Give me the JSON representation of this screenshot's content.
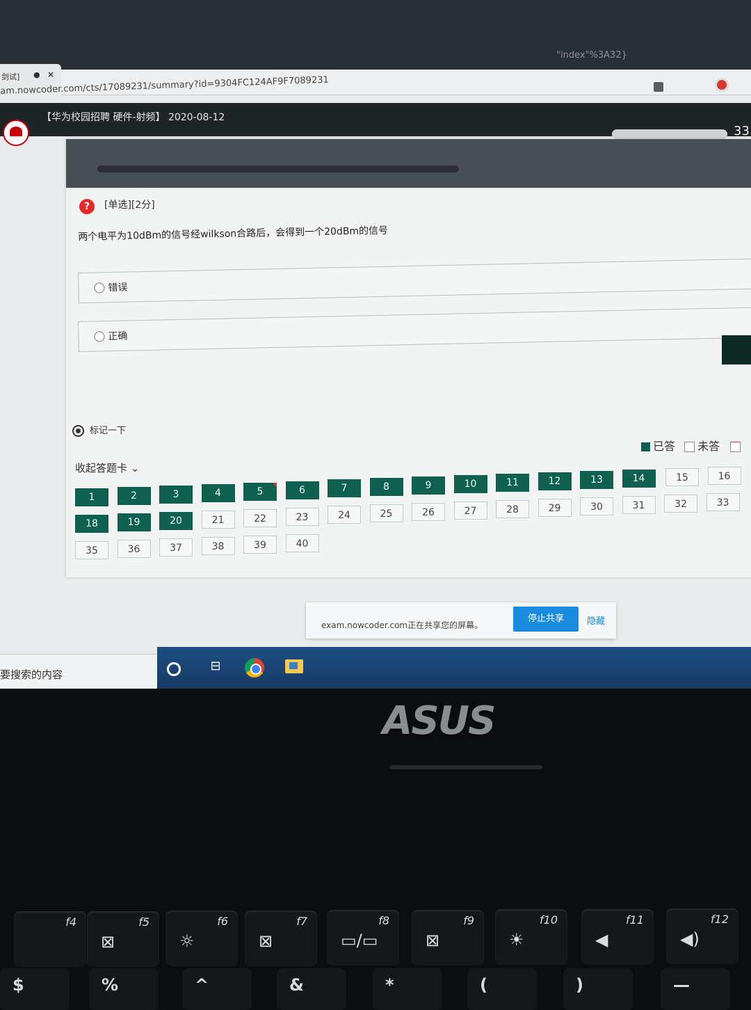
{
  "browser": {
    "tab_title": "剑试]",
    "tab_close": "×",
    "ghost_url": "\"index\"%3A32}",
    "url": "am.nowcoder.com/cts/17089231/summary?id=9304FC124AF9F7089231"
  },
  "header": {
    "exam_title": "【华为校园招聘 硬件-射频】 2020-08-12",
    "progress_number": "33"
  },
  "question": {
    "type_label": "[单选][2分]",
    "icon_glyph": "?",
    "text": "两个电平为10dBm的信号经wilkson合路后，会得到一个20dBm的信号",
    "options": [
      {
        "label": "错误"
      },
      {
        "label": "正确"
      }
    ],
    "mark_label": "标记一下"
  },
  "answer_card": {
    "collapse_label": "收起答题卡 ⌄",
    "legend": {
      "answered": "已答",
      "unanswered": "未答"
    },
    "cells": [
      {
        "num": "1",
        "state": "answered"
      },
      {
        "num": "2",
        "state": "answered"
      },
      {
        "num": "3",
        "state": "answered"
      },
      {
        "num": "4",
        "state": "answered"
      },
      {
        "num": "5",
        "state": "answered",
        "flag": true
      },
      {
        "num": "6",
        "state": "answered"
      },
      {
        "num": "7",
        "state": "answered"
      },
      {
        "num": "8",
        "state": "answered"
      },
      {
        "num": "9",
        "state": "answered"
      },
      {
        "num": "10",
        "state": "answered"
      },
      {
        "num": "11",
        "state": "answered"
      },
      {
        "num": "12",
        "state": "answered"
      },
      {
        "num": "13",
        "state": "answered"
      },
      {
        "num": "14",
        "state": "answered"
      },
      {
        "num": "15",
        "state": "unanswered"
      },
      {
        "num": "16",
        "state": "unanswered"
      },
      {
        "num": "18",
        "state": "answered"
      },
      {
        "num": "19",
        "state": "answered"
      },
      {
        "num": "20",
        "state": "answered"
      },
      {
        "num": "21",
        "state": "unanswered"
      },
      {
        "num": "22",
        "state": "unanswered"
      },
      {
        "num": "23",
        "state": "unanswered"
      },
      {
        "num": "24",
        "state": "unanswered"
      },
      {
        "num": "25",
        "state": "unanswered"
      },
      {
        "num": "26",
        "state": "unanswered"
      },
      {
        "num": "27",
        "state": "unanswered"
      },
      {
        "num": "28",
        "state": "unanswered"
      },
      {
        "num": "29",
        "state": "unanswered"
      },
      {
        "num": "30",
        "state": "unanswered"
      },
      {
        "num": "31",
        "state": "unanswered"
      },
      {
        "num": "32",
        "state": "unanswered"
      },
      {
        "num": "33",
        "state": "unanswered"
      },
      {
        "num": "35",
        "state": "unanswered"
      },
      {
        "num": "36",
        "state": "unanswered"
      },
      {
        "num": "37",
        "state": "unanswered"
      },
      {
        "num": "38",
        "state": "unanswered"
      },
      {
        "num": "39",
        "state": "unanswered"
      },
      {
        "num": "40",
        "state": "unanswered"
      }
    ]
  },
  "share_bar": {
    "message": "exam.nowcoder.com正在共享您的屏幕。",
    "stop_label": "停止共享",
    "hide_label": "隐藏"
  },
  "taskbar": {
    "search_placeholder": "要搜索的内容"
  },
  "laptop": {
    "brand": "ASUS",
    "fn_keys": [
      "f4",
      "f5",
      "f6",
      "f7",
      "f8",
      "f9",
      "f10",
      "f11",
      "f12"
    ],
    "fn_symbols": [
      "⊠",
      "☼",
      "⊠",
      "▭/▭",
      "⊠",
      "☀",
      "◀",
      "◀)"
    ],
    "bottom_keys": [
      "$",
      "%",
      "^",
      "&",
      "*",
      "(",
      ")",
      "—"
    ]
  },
  "colors": {
    "answered": "#10604f",
    "accent_blue": "#1a8ce0",
    "question_icon": "#e8282b"
  }
}
